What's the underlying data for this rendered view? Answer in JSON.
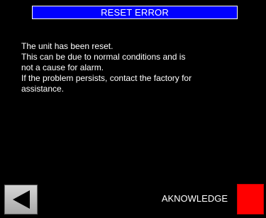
{
  "header": {
    "title": "RESET ERROR"
  },
  "message": {
    "lines": [
      "The unit has been reset.",
      "This can be due to normal conditions and is",
      "not a cause for alarm.",
      "If the problem persists, contact the factory for",
      "assistance."
    ]
  },
  "footer": {
    "back_icon": "left-triangle-icon",
    "acknowledge_label": "AKNOWLEDGE"
  },
  "colors": {
    "background": "#000000",
    "title_bar": "#0000ff",
    "text": "#ffffff",
    "acknowledge_button": "#ff0000",
    "back_button": "#bdbdbd"
  }
}
